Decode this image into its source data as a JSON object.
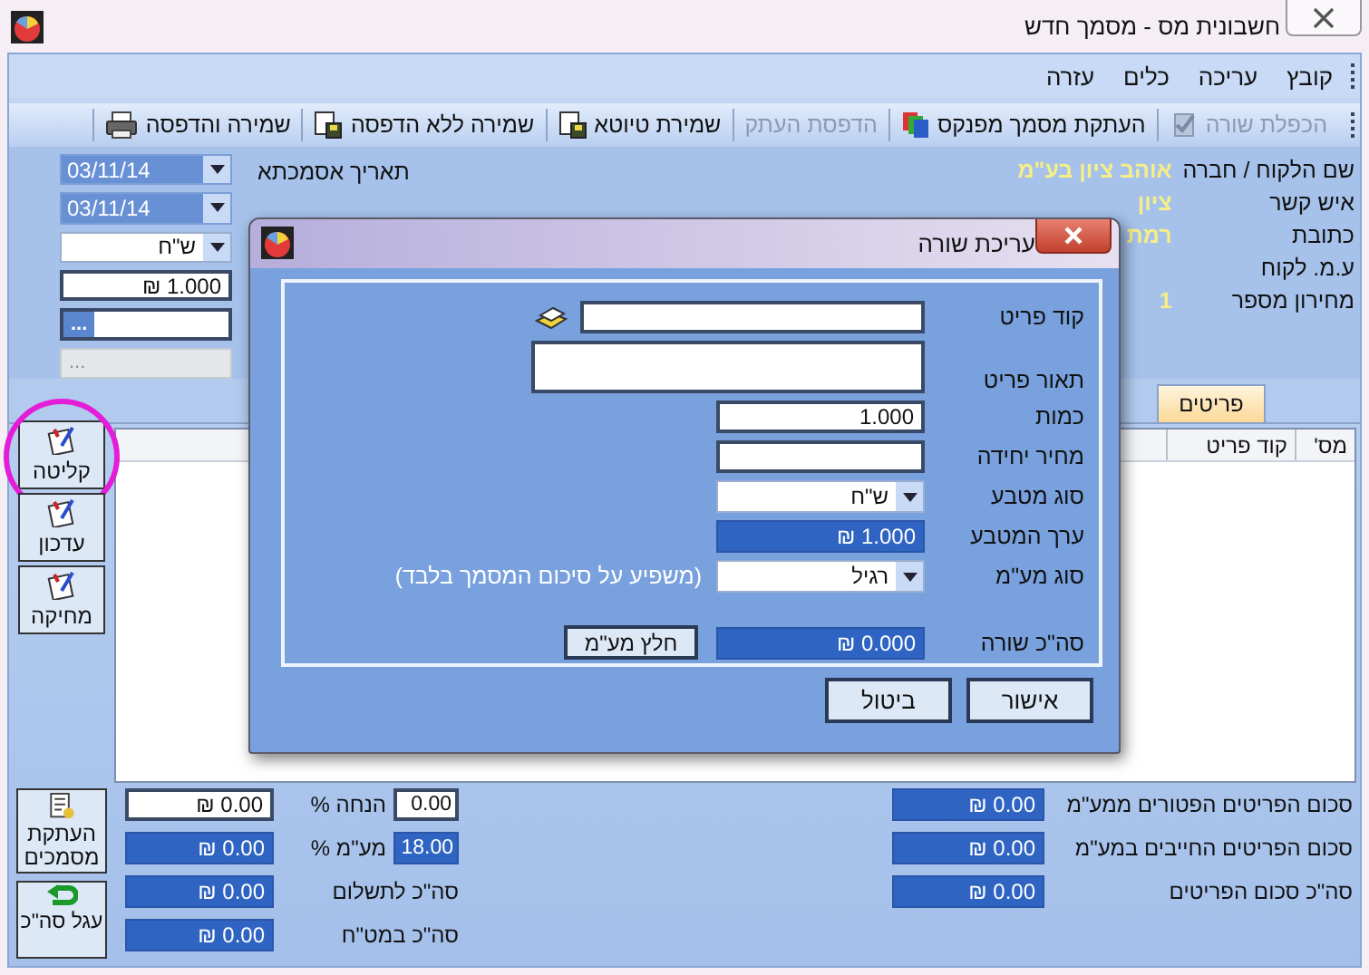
{
  "window": {
    "title": "חשבונית מס -  מסמך חדש"
  },
  "menu": [
    "קובץ",
    "עריכה",
    "כלים",
    "עזרה"
  ],
  "toolbar": [
    {
      "label": "הכפלת שורה",
      "kind": "duplicate",
      "disabled": true
    },
    {
      "label": "העתקת מסמך מפנקס",
      "kind": "copy",
      "disabled": false
    },
    {
      "label": "הדפסת העתק",
      "kind": "plain",
      "disabled": true
    },
    {
      "label": "שמירת טיוטא",
      "kind": "save",
      "disabled": false
    },
    {
      "label": "שמירה ללא הדפסה",
      "kind": "save",
      "disabled": false
    },
    {
      "label": "שמירה והדפסה",
      "kind": "print",
      "disabled": false
    }
  ],
  "customer": [
    {
      "label": "שם הלקוח / חברה",
      "value": "אוהב ציון בע\"מ"
    },
    {
      "label": "איש קשר",
      "value": "ציון"
    },
    {
      "label": "כתובת",
      "value": "רמת"
    },
    {
      "label": "ע.מ. לקוח"
    },
    {
      "label": "מחירון מספר",
      "value": "1"
    }
  ],
  "document_fields": [
    {
      "label": "תאריך אסמכתא",
      "kind": "date",
      "value": "03/11/14"
    },
    {
      "kind": "date",
      "value": "03/11/14"
    },
    {
      "kind": "dropdown",
      "value": "ש\"ח"
    },
    {
      "kind": "text",
      "value": "1.000 ₪"
    },
    {
      "kind": "lookup",
      "button": "...",
      "disabled": false
    },
    {
      "kind": "lookup",
      "button": "...",
      "disabled": true
    }
  ],
  "tabs": [
    {
      "label": "פריטים",
      "selected": true
    }
  ],
  "table": {
    "columns": [
      "מס'",
      "קוד פריט"
    ]
  },
  "row_buttons": [
    {
      "label": "קליטה",
      "highlighted": true
    },
    {
      "label": "עדכון",
      "highlighted": false
    },
    {
      "label": "מחיקה",
      "highlighted": false
    }
  ],
  "summary": {
    "items": [
      {
        "label": "סכום הפריטים הפטורים ממע\"מ",
        "value": "0.00 ₪"
      },
      {
        "label": "סכום הפריטים החייבים במע\"מ",
        "value": "0.00 ₪"
      },
      {
        "label": "סה\"כ סכום הפריטים",
        "value": "0.00 ₪"
      }
    ],
    "totals": [
      {
        "label": "הנחה %",
        "input": "0.00",
        "input_readonly": false,
        "value": "0.00 ₪",
        "value_readonly": false
      },
      {
        "label": "מע\"מ %",
        "input": "18.00",
        "input_readonly": true,
        "value": "0.00 ₪",
        "value_readonly": true
      },
      {
        "label": "סה\"כ לתשלום",
        "value": "0.00 ₪",
        "value_readonly": true
      },
      {
        "label": "סה\"כ במט\"ח",
        "value": "0.00 ₪",
        "value_readonly": true
      }
    ]
  },
  "bottom_buttons": [
    {
      "label": "העתקת מסמכים",
      "kind": "copy-docs"
    },
    {
      "label": "עגל סה\"כ",
      "kind": "round"
    }
  ],
  "dialog": {
    "title": "עריכת שורה",
    "fields": [
      {
        "label": "קוד פריט",
        "kind": "lookup-text"
      },
      {
        "label": "תאור פריט",
        "kind": "textarea"
      },
      {
        "label": "כמות",
        "kind": "text",
        "value": "1.000"
      },
      {
        "label": "מחיר יחידה",
        "kind": "text"
      },
      {
        "label": "סוג מטבע",
        "kind": "dropdown",
        "value": "ש\"ח"
      },
      {
        "label": "ערך המטבע",
        "kind": "value",
        "value": "1.000 ₪"
      },
      {
        "label": "סוג מע\"מ",
        "kind": "dropdown",
        "value": "רגיל",
        "note": "(משפיע על סיכום המסמך בלבד)"
      },
      {
        "label": "סה\"כ שורה",
        "kind": "value",
        "value": "0.000 ₪",
        "button": "חלץ מע\"מ"
      }
    ],
    "buttons": [
      "אישור",
      "ביטול"
    ]
  }
}
